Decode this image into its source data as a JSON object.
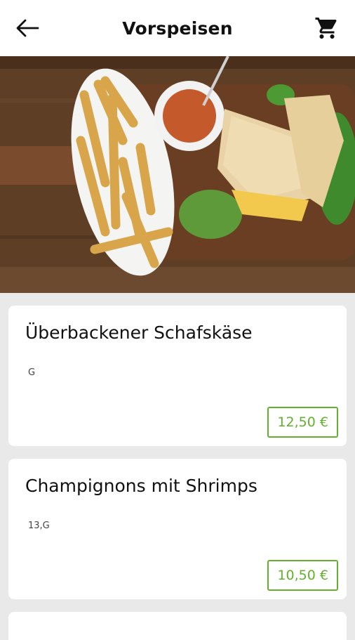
{
  "header": {
    "title": "Vorspeisen",
    "back_icon": "arrow-left-icon",
    "cart_icon": "shopping-cart-icon"
  },
  "colors": {
    "accent": "#63b02e",
    "background": "#e9e9e9",
    "card": "#ffffff"
  },
  "items": [
    {
      "name": "Überbackener Schafskäse",
      "allergens": "G",
      "price": "12,50 €"
    },
    {
      "name": "Champignons mit Shrimps",
      "allergens": "13,G",
      "price": "10,50 €"
    }
  ]
}
